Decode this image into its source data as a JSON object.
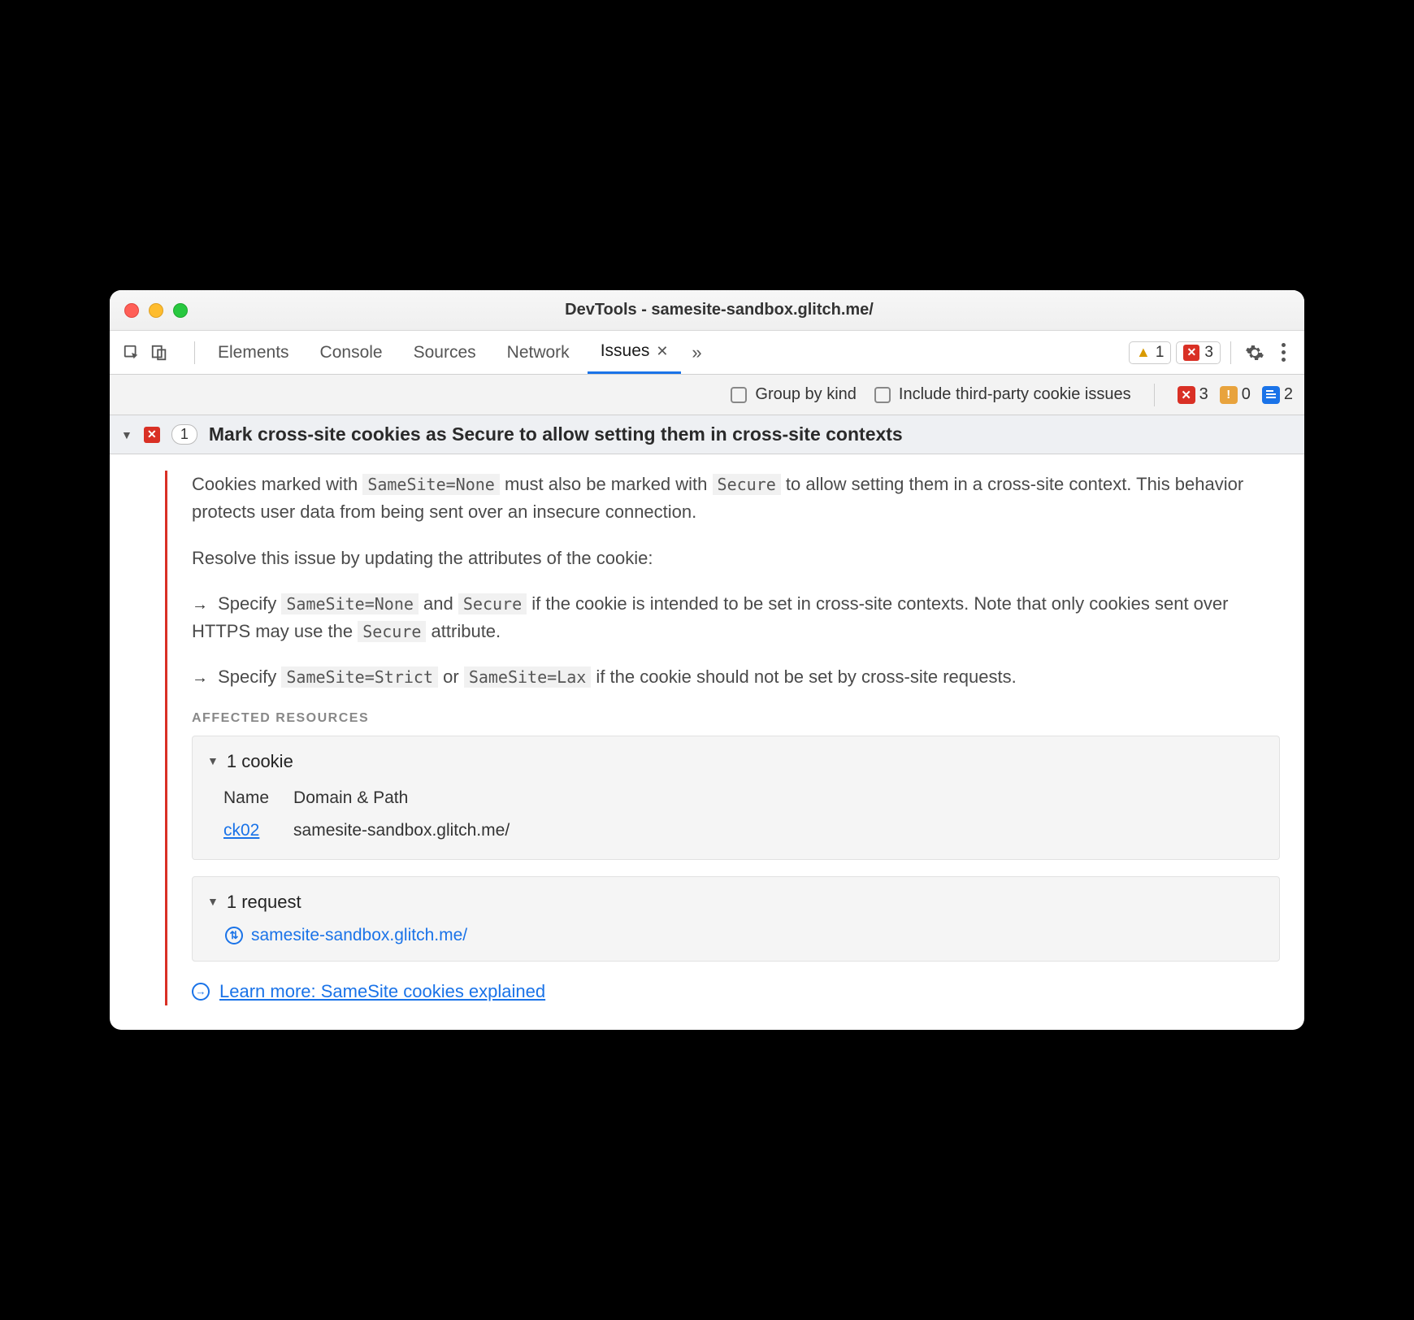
{
  "window": {
    "title": "DevTools - samesite-sandbox.glitch.me/"
  },
  "tabs": {
    "elements": "Elements",
    "console": "Console",
    "sources": "Sources",
    "network": "Network",
    "issues": "Issues"
  },
  "badges": {
    "warn_count": "1",
    "err_count": "3"
  },
  "filters": {
    "group_by_kind": "Group by kind",
    "include_third_party": "Include third-party cookie issues",
    "err": "3",
    "warn": "0",
    "info": "2"
  },
  "issue": {
    "count": "1",
    "title": "Mark cross-site cookies as Secure to allow setting them in cross-site contexts",
    "p1a": "Cookies marked with ",
    "p1_code1": "SameSite=None",
    "p1b": " must also be marked with ",
    "p1_code2": "Secure",
    "p1c": " to allow setting them in a cross-site context. This behavior protects user data from being sent over an insecure connection.",
    "p2": "Resolve this issue by updating the attributes of the cookie:",
    "b1a": "Specify ",
    "b1_code1": "SameSite=None",
    "b1b": " and ",
    "b1_code2": "Secure",
    "b1c": " if the cookie is intended to be set in cross-site contexts. Note that only cookies sent over HTTPS may use the ",
    "b1_code3": "Secure",
    "b1d": " attribute.",
    "b2a": "Specify ",
    "b2_code1": "SameSite=Strict",
    "b2b": " or ",
    "b2_code2": "SameSite=Lax",
    "b2c": " if the cookie should not be set by cross-site requests.",
    "affected_label": "AFFECTED RESOURCES",
    "cookies_header": "1 cookie",
    "col_name": "Name",
    "col_domain": "Domain & Path",
    "cookie_name": "ck02",
    "cookie_domain": "samesite-sandbox.glitch.me/",
    "requests_header": "1 request",
    "request_url": "samesite-sandbox.glitch.me/",
    "learn_more": "Learn more: SameSite cookies explained"
  }
}
